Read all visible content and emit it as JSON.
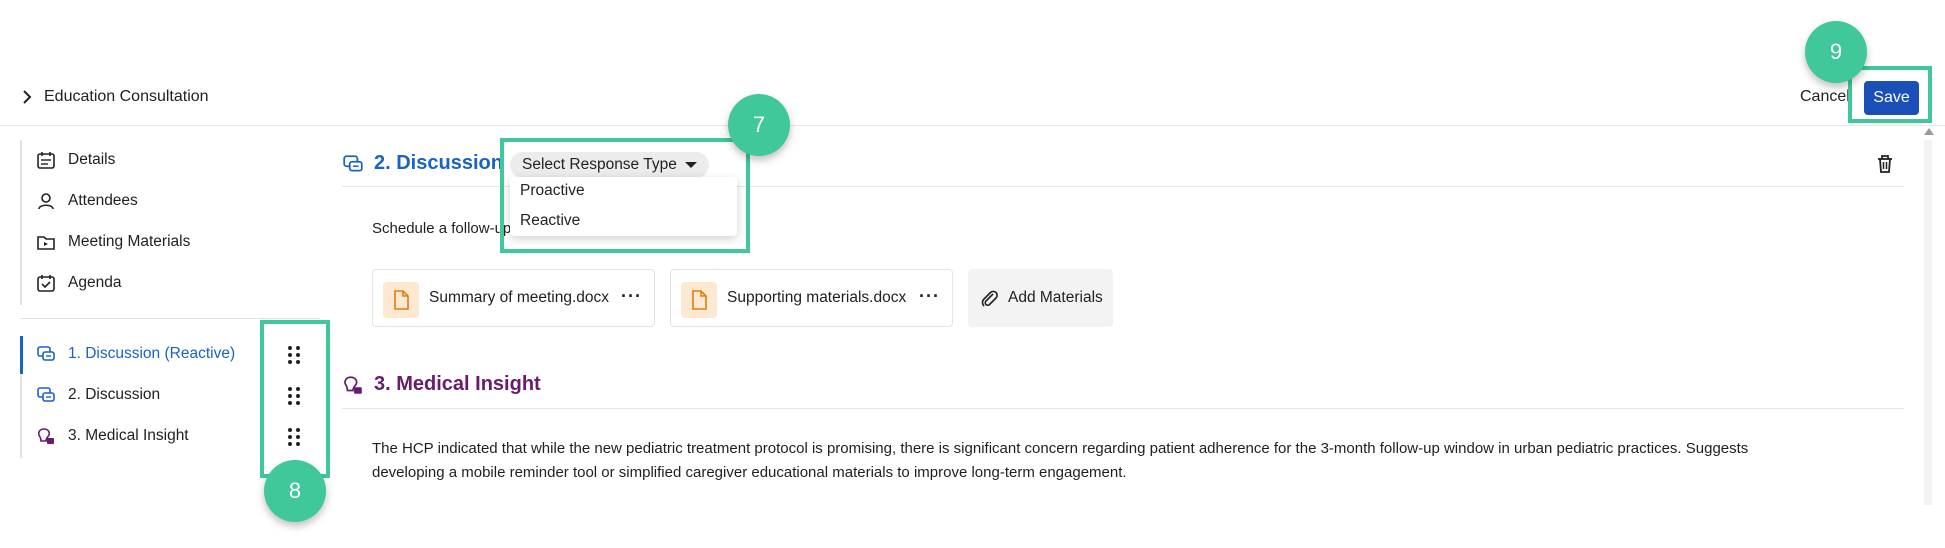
{
  "header": {
    "breadcrumb": "Education Consultation",
    "cancel_label": "Cancel",
    "save_label": "Save"
  },
  "sidebar": {
    "nav": [
      {
        "label": "Details",
        "icon": "calendar-details-icon"
      },
      {
        "label": "Attendees",
        "icon": "person-icon"
      },
      {
        "label": "Meeting Materials",
        "icon": "folder-icon"
      },
      {
        "label": "Agenda",
        "icon": "calendar-check-icon"
      }
    ],
    "agenda_items": [
      {
        "label": "1. Discussion (Reactive)",
        "icon": "discussion-icon",
        "active": true
      },
      {
        "label": "2. Discussion",
        "icon": "discussion-icon",
        "active": false
      },
      {
        "label": "3. Medical Insight",
        "icon": "insight-icon",
        "active": false
      }
    ]
  },
  "main": {
    "discussion": {
      "title": "2. Discussion",
      "response_type_label": "Select Response Type",
      "options": [
        "Proactive",
        "Reactive"
      ],
      "note": "Schedule a follow-up",
      "files": [
        {
          "name": "Summary of meeting.docx"
        },
        {
          "name": "Supporting materials.docx"
        }
      ],
      "add_materials_label": "Add Materials"
    },
    "insight": {
      "title": "3. Medical Insight",
      "text_line1": "The HCP indicated that while the new pediatric treatment protocol is promising, there is significant concern regarding patient adherence for the 3-month follow-up window in urban pediatric practices. Suggests",
      "text_line2": "developing a mobile reminder tool or simplified caregiver educational materials to improve long-term engagement."
    }
  },
  "annotations": {
    "badge_7": "7",
    "badge_8": "8",
    "badge_9": "9"
  },
  "colors": {
    "accent": "#1a62c4",
    "save_button": "#1a4fb8",
    "insight": "#6a1b6e",
    "highlight": "#40c79a"
  }
}
